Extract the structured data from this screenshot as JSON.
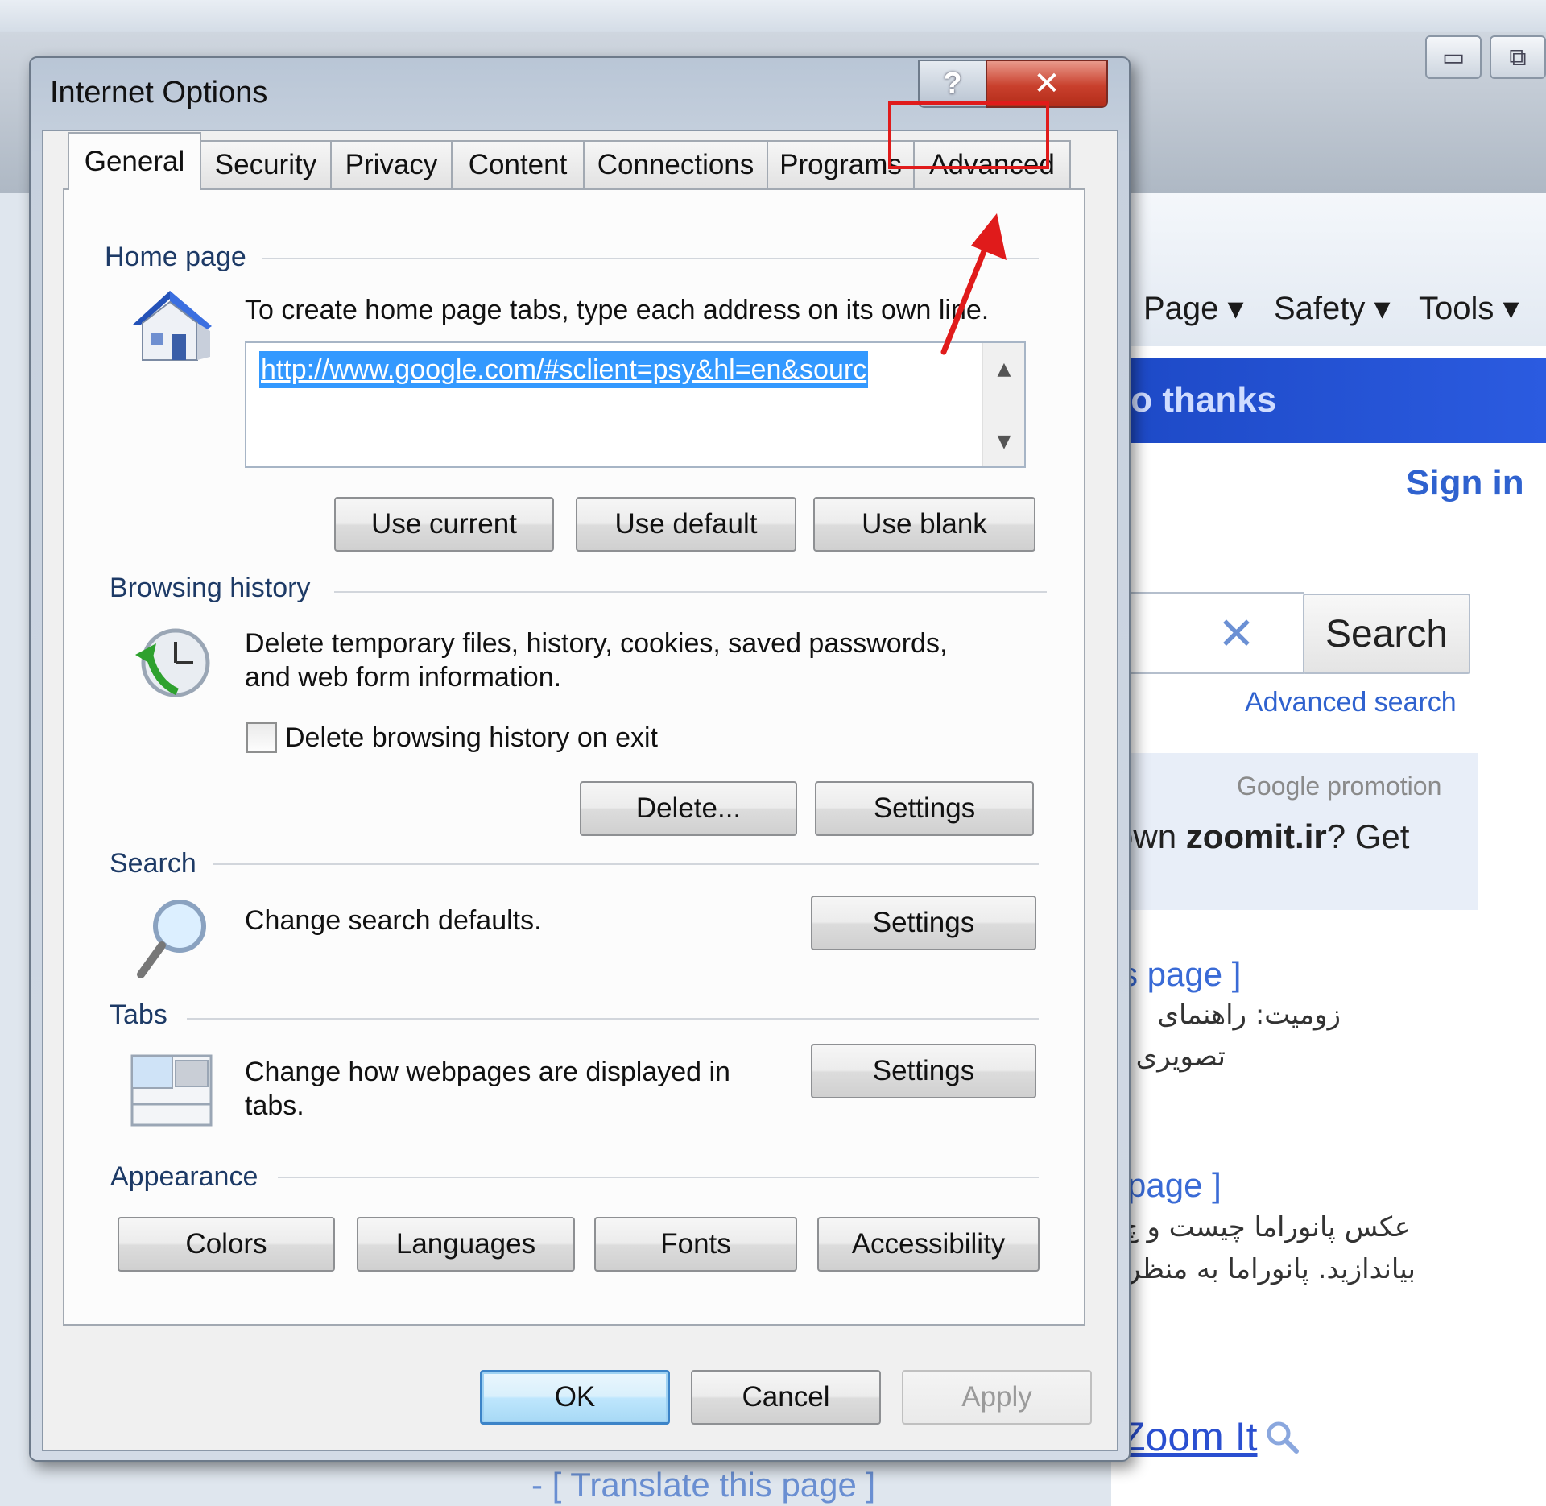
{
  "dialog": {
    "title": "Internet Options",
    "help_label": "?",
    "close_label": "✕",
    "tabs": [
      {
        "label": "General",
        "active": true
      },
      {
        "label": "Security"
      },
      {
        "label": "Privacy"
      },
      {
        "label": "Content"
      },
      {
        "label": "Connections"
      },
      {
        "label": "Programs"
      },
      {
        "label": "Advanced",
        "highlighted": true
      }
    ],
    "home_page": {
      "section_label": "Home page",
      "description": "To create home page tabs, type each address on its own line.",
      "url_value": "http://www.google.com/#sclient=psy&hl=en&sourc",
      "buttons": {
        "use_current": "Use current",
        "use_default": "Use default",
        "use_blank": "Use blank"
      }
    },
    "browsing_history": {
      "section_label": "Browsing history",
      "description_line1": "Delete temporary files, history, cookies, saved passwords,",
      "description_line2": "and web form information.",
      "checkbox_label": "Delete browsing history on exit",
      "checkbox_checked": false,
      "buttons": {
        "delete": "Delete...",
        "settings": "Settings"
      }
    },
    "search": {
      "section_label": "Search",
      "description": "Change search defaults.",
      "settings_label": "Settings"
    },
    "tabs_section": {
      "section_label": "Tabs",
      "description_line1": "Change how webpages are displayed in",
      "description_line2": "tabs.",
      "settings_label": "Settings"
    },
    "appearance": {
      "section_label": "Appearance",
      "buttons": {
        "colors": "Colors",
        "languages": "Languages",
        "fonts": "Fonts",
        "accessibility": "Accessibility"
      }
    },
    "footer": {
      "ok": "OK",
      "cancel": "Cancel",
      "apply": "Apply"
    }
  },
  "background": {
    "command_bar": [
      "Page ▾",
      "Safety ▾",
      "Tools ▾"
    ],
    "no_thanks": "lo thanks",
    "sign_in": "Sign in",
    "search_button": "Search",
    "search_clear": "✕",
    "advanced_search": "Advanced search",
    "promo_label": "Google promotion",
    "promo_text_plain": "own ",
    "promo_text_bold": "zoomit.ir",
    "promo_text_end": "? Get",
    "link_1": "s page ]",
    "fa_line_1": "زومیت: راهنمای",
    "fa_line_2": "تصویری",
    "link_2": "page ]",
    "fa_line_3": "عکس پانوراما چیست و چ",
    "fa_line_4": "بیاندازید. پانوراما به منظر",
    "zoom_it": "Zoom It",
    "translate": "- [ Translate this page ]"
  },
  "colors": {
    "highlight_red": "#e01b1b",
    "selection_blue": "#3399ff",
    "google_bar_blue": "#1d49c6"
  }
}
